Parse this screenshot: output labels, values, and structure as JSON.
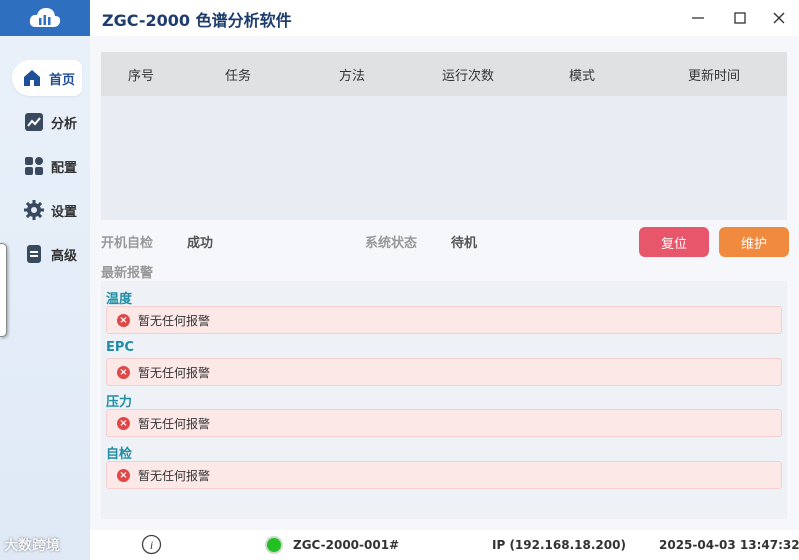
{
  "app": {
    "title": "ZGC-2000 色谱分析软件"
  },
  "sidebar": {
    "items": [
      {
        "label": "首页",
        "icon": "home-icon"
      },
      {
        "label": "分析",
        "icon": "chart-icon"
      },
      {
        "label": "配置",
        "icon": "grid-icon"
      },
      {
        "label": "设置",
        "icon": "gear-icon"
      },
      {
        "label": "高级",
        "icon": "document-icon"
      }
    ]
  },
  "table": {
    "columns": [
      "序号",
      "任务",
      "方法",
      "运行次数",
      "模式",
      "更新时间"
    ],
    "rows": []
  },
  "status": {
    "selftest_label": "开机自检",
    "selftest_value": "成功",
    "system_label": "系统状态",
    "system_value": "待机"
  },
  "buttons": {
    "reset": "复位",
    "maintain": "维护"
  },
  "alarms": {
    "title": "最新报警",
    "categories": [
      {
        "name": "温度",
        "message": "暂无任何报警"
      },
      {
        "name": "EPC",
        "message": "暂无任何报警"
      },
      {
        "name": "压力",
        "message": "暂无任何报警"
      },
      {
        "name": "自检",
        "message": "暂无任何报警"
      }
    ]
  },
  "statusbar": {
    "device": "ZGC-2000-001#",
    "ip": "IP (192.168.18.200)",
    "datetime": "2025-04-03 13:47:32"
  },
  "watermark": "大数跨境",
  "colors": {
    "accent": "#2f6fc0",
    "reset": "#e8566c",
    "maintain": "#f08a3e",
    "category": "#1d8ea3",
    "online": "#22c022"
  }
}
